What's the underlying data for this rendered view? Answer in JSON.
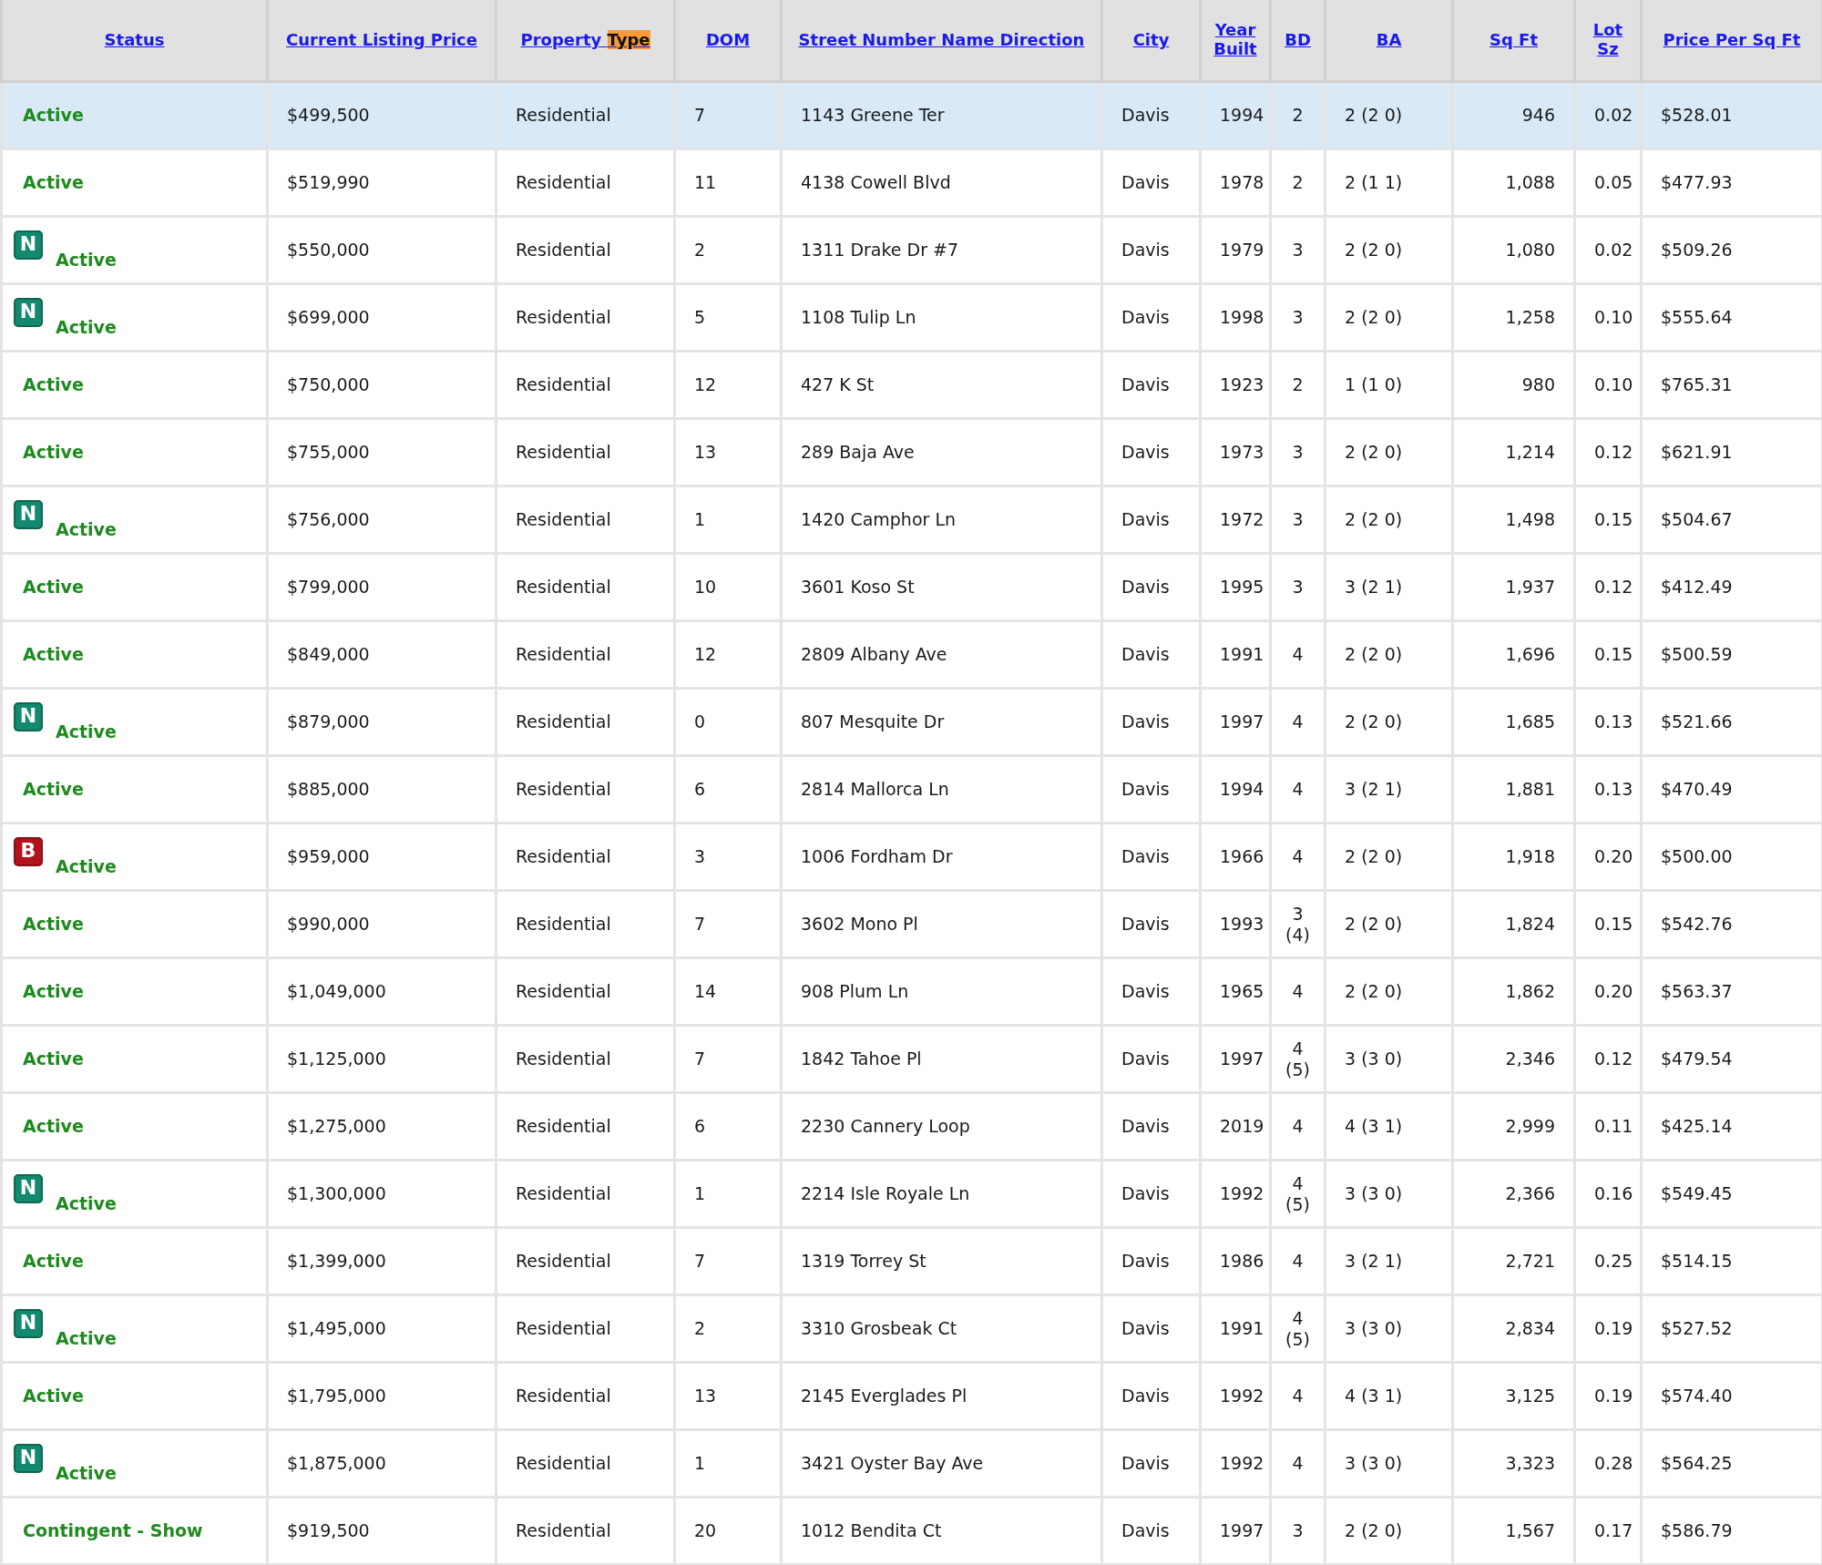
{
  "table": {
    "columns": [
      {
        "label": "Status"
      },
      {
        "label": "Current Listing Price"
      },
      {
        "label": "Property",
        "highlight": "Type"
      },
      {
        "label": "DOM"
      },
      {
        "label": "Street Number Name Direction"
      },
      {
        "label": "City"
      },
      {
        "label": "Year Built"
      },
      {
        "label": "BD"
      },
      {
        "label": "BA"
      },
      {
        "label": "Sq Ft"
      },
      {
        "label": "Lot Sz"
      },
      {
        "label": "Price Per Sq Ft"
      }
    ],
    "rows": [
      {
        "selected": true,
        "cells": [
          "Active",
          "$499,500",
          "Residential",
          "7",
          "1143 Greene Ter",
          "Davis",
          "1994",
          "2",
          "2 (2 0)",
          "946",
          "0.02",
          "$528.01"
        ]
      },
      {
        "selected": false,
        "cells": [
          "Active",
          "$519,990",
          "Residential",
          "11",
          "4138 Cowell Blvd",
          "Davis",
          "1978",
          "2",
          "2 (1 1)",
          "1,088",
          "0.05",
          "$477.93"
        ]
      },
      {
        "selected": false,
        "badge": {
          "text": "N",
          "color": "#138a6e"
        },
        "cells": [
          "Active",
          "$550,000",
          "Residential",
          "2",
          "1311 Drake Dr #7",
          "Davis",
          "1979",
          "3",
          "2 (2 0)",
          "1,080",
          "0.02",
          "$509.26"
        ]
      },
      {
        "selected": false,
        "badge": {
          "text": "N",
          "color": "#138a6e"
        },
        "cells": [
          "Active",
          "$699,000",
          "Residential",
          "5",
          "1108 Tulip Ln",
          "Davis",
          "1998",
          "3",
          "2 (2 0)",
          "1,258",
          "0.10",
          "$555.64"
        ]
      },
      {
        "selected": false,
        "cells": [
          "Active",
          "$750,000",
          "Residential",
          "12",
          "427 K St",
          "Davis",
          "1923",
          "2",
          "1 (1 0)",
          "980",
          "0.10",
          "$765.31"
        ]
      },
      {
        "selected": false,
        "cells": [
          "Active",
          "$755,000",
          "Residential",
          "13",
          "289 Baja Ave",
          "Davis",
          "1973",
          "3",
          "2 (2 0)",
          "1,214",
          "0.12",
          "$621.91"
        ]
      },
      {
        "selected": false,
        "badge": {
          "text": "N",
          "color": "#138a6e"
        },
        "cells": [
          "Active",
          "$756,000",
          "Residential",
          "1",
          "1420 Camphor Ln",
          "Davis",
          "1972",
          "3",
          "2 (2 0)",
          "1,498",
          "0.15",
          "$504.67"
        ]
      },
      {
        "selected": false,
        "cells": [
          "Active",
          "$799,000",
          "Residential",
          "10",
          "3601 Koso St",
          "Davis",
          "1995",
          "3",
          "3 (2 1)",
          "1,937",
          "0.12",
          "$412.49"
        ]
      },
      {
        "selected": false,
        "cells": [
          "Active",
          "$849,000",
          "Residential",
          "12",
          "2809 Albany Ave",
          "Davis",
          "1991",
          "4",
          "2 (2 0)",
          "1,696",
          "0.15",
          "$500.59"
        ]
      },
      {
        "selected": false,
        "badge": {
          "text": "N",
          "color": "#138a6e"
        },
        "cells": [
          "Active",
          "$879,000",
          "Residential",
          "0",
          "807 Mesquite Dr",
          "Davis",
          "1997",
          "4",
          "2 (2 0)",
          "1,685",
          "0.13",
          "$521.66"
        ]
      },
      {
        "selected": false,
        "cells": [
          "Active",
          "$885,000",
          "Residential",
          "6",
          "2814 Mallorca Ln",
          "Davis",
          "1994",
          "4",
          "3 (2 1)",
          "1,881",
          "0.13",
          "$470.49"
        ]
      },
      {
        "selected": false,
        "badge": {
          "text": "B",
          "color": "#b3141c"
        },
        "cells": [
          "Active",
          "$959,000",
          "Residential",
          "3",
          "1006 Fordham Dr",
          "Davis",
          "1966",
          "4",
          "2 (2 0)",
          "1,918",
          "0.20",
          "$500.00"
        ]
      },
      {
        "selected": false,
        "cells": [
          "Active",
          "$990,000",
          "Residential",
          "7",
          "3602 Mono Pl",
          "Davis",
          "1993",
          "3 (4)",
          "2 (2 0)",
          "1,824",
          "0.15",
          "$542.76"
        ]
      },
      {
        "selected": false,
        "cells": [
          "Active",
          "$1,049,000",
          "Residential",
          "14",
          "908 Plum Ln",
          "Davis",
          "1965",
          "4",
          "2 (2 0)",
          "1,862",
          "0.20",
          "$563.37"
        ]
      },
      {
        "selected": false,
        "cells": [
          "Active",
          "$1,125,000",
          "Residential",
          "7",
          "1842 Tahoe Pl",
          "Davis",
          "1997",
          "4 (5)",
          "3 (3 0)",
          "2,346",
          "0.12",
          "$479.54"
        ]
      },
      {
        "selected": false,
        "cells": [
          "Active",
          "$1,275,000",
          "Residential",
          "6",
          "2230 Cannery Loop",
          "Davis",
          "2019",
          "4",
          "4 (3 1)",
          "2,999",
          "0.11",
          "$425.14"
        ]
      },
      {
        "selected": false,
        "badge": {
          "text": "N",
          "color": "#138a6e"
        },
        "cells": [
          "Active",
          "$1,300,000",
          "Residential",
          "1",
          "2214 Isle Royale Ln",
          "Davis",
          "1992",
          "4 (5)",
          "3 (3 0)",
          "2,366",
          "0.16",
          "$549.45"
        ]
      },
      {
        "selected": false,
        "cells": [
          "Active",
          "$1,399,000",
          "Residential",
          "7",
          "1319 Torrey St",
          "Davis",
          "1986",
          "4",
          "3 (2 1)",
          "2,721",
          "0.25",
          "$514.15"
        ]
      },
      {
        "selected": false,
        "badge": {
          "text": "N",
          "color": "#138a6e"
        },
        "cells": [
          "Active",
          "$1,495,000",
          "Residential",
          "2",
          "3310 Grosbeak Ct",
          "Davis",
          "1991",
          "4 (5)",
          "3 (3 0)",
          "2,834",
          "0.19",
          "$527.52"
        ]
      },
      {
        "selected": false,
        "cells": [
          "Active",
          "$1,795,000",
          "Residential",
          "13",
          "2145 Everglades Pl",
          "Davis",
          "1992",
          "4",
          "4 (3 1)",
          "3,125",
          "0.19",
          "$574.40"
        ]
      },
      {
        "selected": false,
        "badge": {
          "text": "N",
          "color": "#138a6e"
        },
        "cells": [
          "Active",
          "$1,875,000",
          "Residential",
          "1",
          "3421 Oyster Bay Ave",
          "Davis",
          "1992",
          "4",
          "3 (3 0)",
          "3,323",
          "0.28",
          "$564.25"
        ]
      },
      {
        "selected": false,
        "cells": [
          "Contingent - Show",
          "$919,500",
          "Residential",
          "20",
          "1012 Bendita Ct",
          "Davis",
          "1997",
          "3",
          "2 (2 0)",
          "1,567",
          "0.17",
          "$586.79"
        ]
      }
    ]
  }
}
